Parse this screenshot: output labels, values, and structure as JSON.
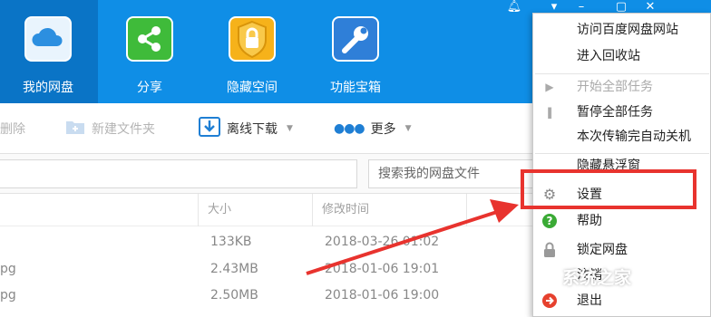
{
  "nav": {
    "items": [
      {
        "label": "我的网盘",
        "icon": "cloud-icon"
      },
      {
        "label": "分享",
        "icon": "share-icon"
      },
      {
        "label": "隐藏空间",
        "icon": "lock-icon"
      },
      {
        "label": "功能宝箱",
        "icon": "toolbox-icon"
      }
    ]
  },
  "title_controls": {
    "notify": "bell-icon",
    "menu": "dropdown-arrow-icon",
    "minimize": "minimize-icon",
    "maximize": "maximize-icon",
    "close": "close-icon"
  },
  "toolbar": {
    "delete_label": "删除",
    "new_folder_label": "新建文件夹",
    "offline_download_label": "离线下载",
    "more_label": "更多"
  },
  "search": {
    "placeholder": "搜索我的网盘文件"
  },
  "columns": {
    "size": "大小",
    "modified": "修改时间"
  },
  "files": [
    {
      "name": "",
      "size": "133KB",
      "modified": "2018-03-26 01:02"
    },
    {
      "name": "pg",
      "size": "2.43MB",
      "modified": "2018-01-06 19:01"
    },
    {
      "name": "pg",
      "size": "2.50MB",
      "modified": "2018-01-06 19:00"
    }
  ],
  "menu": {
    "visit_site": "访问百度网盘网站",
    "recycle_bin": "进入回收站",
    "start_all": "开始全部任务",
    "pause_all": "暂停全部任务",
    "shutdown_after": "本次传输完自动关机",
    "hide_floating": "隐藏悬浮窗",
    "settings": "设置",
    "help": "帮助",
    "lock": "锁定网盘",
    "logout": "注销",
    "exit": "退出"
  },
  "watermark": "系统之家",
  "colors": {
    "header_blue": "#0f8ee6",
    "active_blue": "#0a74c6",
    "highlight_red": "#e8332e"
  }
}
